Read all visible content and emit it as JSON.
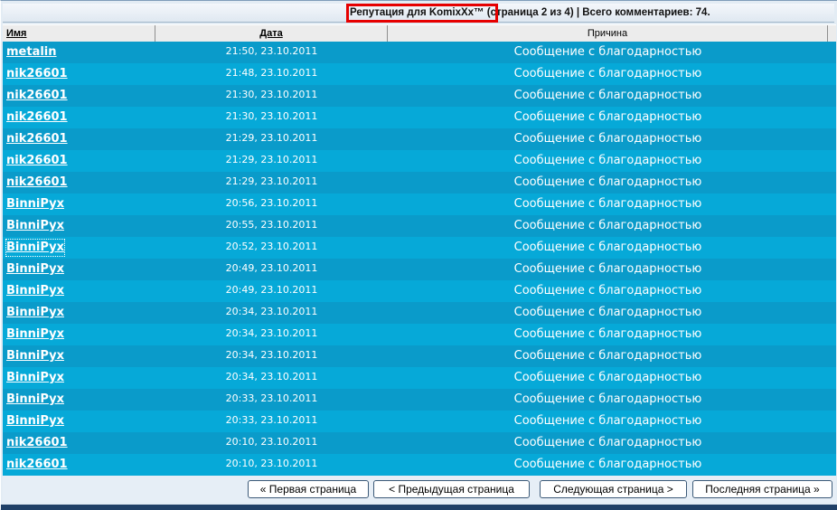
{
  "page": {
    "title": "Репутация для KomixXx™ (страница 2 из 4) | Всего комментариев: 74."
  },
  "table": {
    "headers": {
      "name": "Имя",
      "date": "Дата",
      "reason": "Причина"
    },
    "rows": [
      {
        "name": "metalin",
        "date": "21:50, 23.10.2011",
        "reason": "Сообщение с благодарностью"
      },
      {
        "name": "nik26601",
        "date": "21:48, 23.10.2011",
        "reason": "Сообщение с благодарностью"
      },
      {
        "name": "nik26601",
        "date": "21:30, 23.10.2011",
        "reason": "Сообщение с благодарностью"
      },
      {
        "name": "nik26601",
        "date": "21:30, 23.10.2011",
        "reason": "Сообщение с благодарностью"
      },
      {
        "name": "nik26601",
        "date": "21:29, 23.10.2011",
        "reason": "Сообщение с благодарностью"
      },
      {
        "name": "nik26601",
        "date": "21:29, 23.10.2011",
        "reason": "Сообщение с благодарностью"
      },
      {
        "name": "nik26601",
        "date": "21:29, 23.10.2011",
        "reason": "Сообщение с благодарностью"
      },
      {
        "name": "BinniPyx",
        "date": "20:56, 23.10.2011",
        "reason": "Сообщение с благодарностью"
      },
      {
        "name": "BinniPyx",
        "date": "20:55, 23.10.2011",
        "reason": "Сообщение с благодарностью"
      },
      {
        "name": "BinniPyx",
        "date": "20:52, 23.10.2011",
        "reason": "Сообщение с благодарностью"
      },
      {
        "name": "BinniPyx",
        "date": "20:49, 23.10.2011",
        "reason": "Сообщение с благодарностью"
      },
      {
        "name": "BinniPyx",
        "date": "20:49, 23.10.2011",
        "reason": "Сообщение с благодарностью"
      },
      {
        "name": "BinniPyx",
        "date": "20:34, 23.10.2011",
        "reason": "Сообщение с благодарностью"
      },
      {
        "name": "BinniPyx",
        "date": "20:34, 23.10.2011",
        "reason": "Сообщение с благодарностью"
      },
      {
        "name": "BinniPyx",
        "date": "20:34, 23.10.2011",
        "reason": "Сообщение с благодарностью"
      },
      {
        "name": "BinniPyx",
        "date": "20:34, 23.10.2011",
        "reason": "Сообщение с благодарностью"
      },
      {
        "name": "BinniPyx",
        "date": "20:33, 23.10.2011",
        "reason": "Сообщение с благодарностью"
      },
      {
        "name": "BinniPyx",
        "date": "20:33, 23.10.2011",
        "reason": "Сообщение с благодарностью"
      },
      {
        "name": "nik26601",
        "date": "20:10, 23.10.2011",
        "reason": "Сообщение с благодарностью"
      },
      {
        "name": "nik26601",
        "date": "20:10, 23.10.2011",
        "reason": "Сообщение с благодарностью"
      }
    ]
  },
  "pagination": {
    "first": "« Первая страница",
    "prev": "< Предыдущая страница",
    "next": "Следующая страница >",
    "last": "Последняя страница »"
  },
  "colors": {
    "row_odd": "#0a9bca",
    "row_even": "#06a9d8",
    "highlight": "#e60000"
  }
}
